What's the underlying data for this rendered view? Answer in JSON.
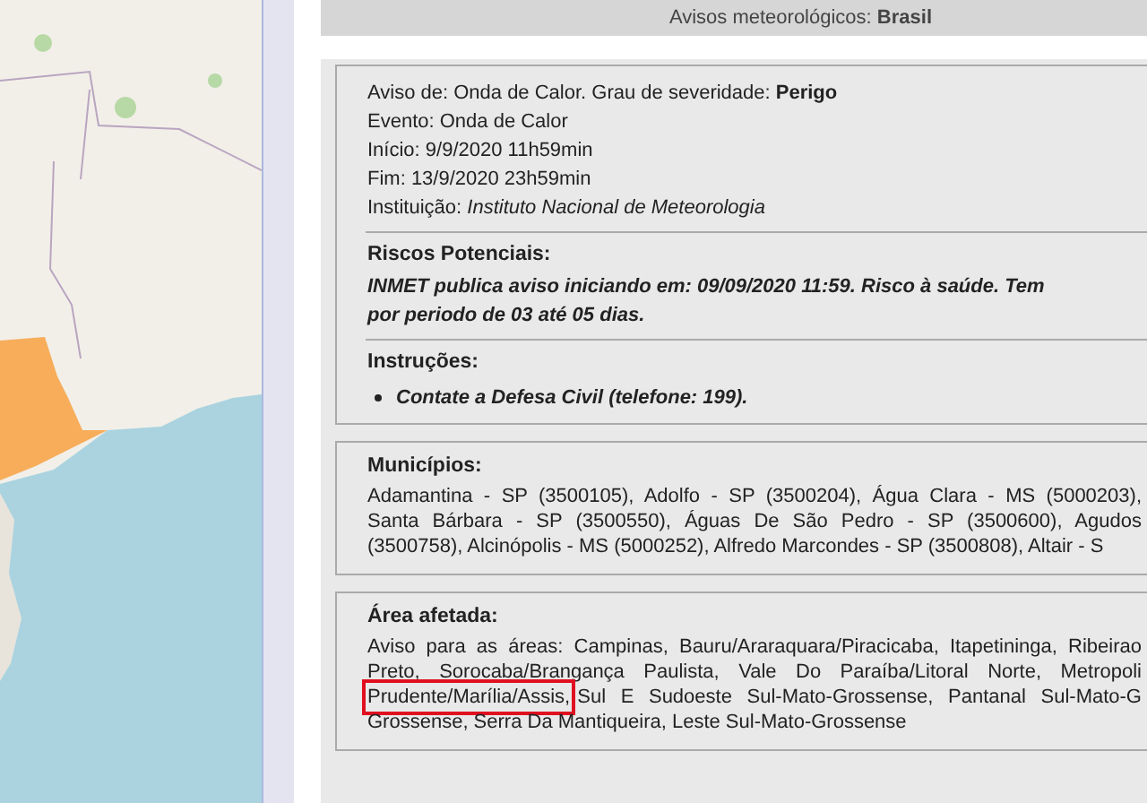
{
  "header": {
    "text": "Avisos meteorológicos: **Brasil**"
  },
  "alert": {
    "lines": [
      "Aviso de: Onda de Calor. Grau de severidade: **Perigo**",
      "Evento: Onda de Calor",
      "Início: 9/9/2020 11h59min",
      "Fim: 13/9/2020 23h59min",
      "Instituição: *Instituto Nacional de Meteorologia*"
    ]
  },
  "risks": {
    "heading": "Riscos Potenciais:",
    "lines": [
      "INMET publica aviso iniciando em: 09/09/2020 11:59. Risco à saúde. Tem",
      "por periodo de 03 até 05 dias."
    ]
  },
  "instructions": {
    "heading": "Instruções:",
    "items": [
      "Contate a Defesa Civil (telefone: 199)."
    ]
  },
  "municipalities": {
    "heading": "Municípios:",
    "lines": [
      [
        {
          "text": "Adamantina - SP (3500105), Adolfo - SP (3500204), Água Clara - MS (5000203),",
          "highlighted": false
        }
      ],
      [
        {
          "text": "Santa Bárbara - SP (3500550), Águas De São Pedro - SP (3500600), Agudos",
          "highlighted": false
        }
      ],
      [
        {
          "text": "(3500758), Alcinópolis - MS (5000252), Alfredo Marcondes - SP (3500808), Altair - S",
          "highlighted": false
        }
      ]
    ]
  },
  "area": {
    "heading": "Área afetada:",
    "lines": [
      [
        {
          "text": "Aviso para as áreas: Campinas, Bauru/Araraquara/Piracicaba, Itapetininga, Ribeirao",
          "highlighted": false
        }
      ],
      [
        {
          "text": "Preto, Sorocaba/Brangança Paulista, Vale Do Paraíba/Litoral Norte, Metropoli",
          "highlighted": false
        }
      ],
      [
        {
          "text": "Prudente/Marília/Assis,",
          "highlighted": true
        },
        {
          "text": "Sul E Sudoeste Sul-Mato-Grossense, Pantanal Sul-Mato-G",
          "highlighted": false
        }
      ],
      [
        {
          "text": "Grossense, Serra Da Mantiqueira, Leste Sul-Mato-Grossense",
          "highlighted": false
        }
      ]
    ]
  }
}
